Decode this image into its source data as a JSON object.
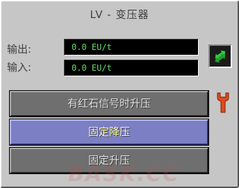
{
  "window": {
    "title": "LV - 变压器"
  },
  "readouts": {
    "output_label": "输出:",
    "output_value": "0.0 EU/t",
    "input_label": "输入:",
    "input_value": "0.0 EU/t"
  },
  "modes": {
    "redstone_boost_label": "有红石信号时升压",
    "fixed_step_down_label": "固定降压",
    "fixed_step_up_label": "固定升压",
    "selected": "固定降压"
  },
  "icons": {
    "swap": "swap-arrows-icon",
    "wrench": "wrench-icon"
  },
  "colors": {
    "panel": "#c6c6c6",
    "display_text": "#66dd66",
    "selected_button": "#7d7fc4",
    "selected_text": "#ffffa0",
    "swap_icon": "#2ecc40",
    "wrench": "#e04a1a"
  },
  "watermark": "BASK.CC"
}
